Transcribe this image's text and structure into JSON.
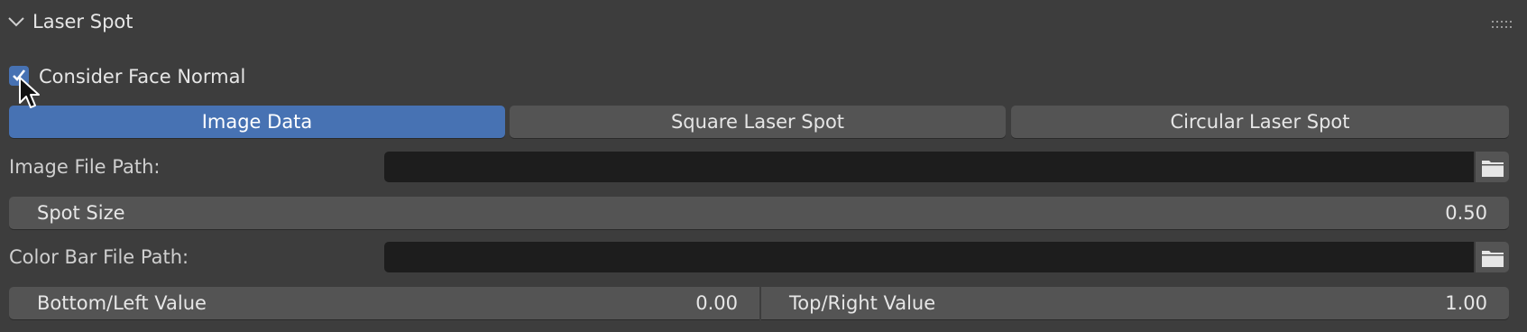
{
  "panel": {
    "title": "Laser Spot",
    "chevron_icon": "chevron-down-icon",
    "grip_icon": "drag-grip-icon"
  },
  "options": {
    "consider_face_normal": {
      "label": "Consider Face Normal",
      "checked": true
    }
  },
  "tabs": [
    {
      "label": "Image Data",
      "active": true
    },
    {
      "label": "Square Laser Spot",
      "active": false
    },
    {
      "label": "Circular Laser Spot",
      "active": false
    }
  ],
  "image_file": {
    "label": "Image File Path:",
    "value": ""
  },
  "spot_size": {
    "label": "Spot Size",
    "value": "0.50"
  },
  "color_bar_file": {
    "label": "Color Bar File Path:",
    "value": ""
  },
  "range": {
    "bottom_left": {
      "label": "Bottom/Left Value",
      "value": "0.00"
    },
    "top_right": {
      "label": "Top/Right Value",
      "value": "1.00"
    }
  },
  "colors": {
    "accent": "#4772b3",
    "panel_bg": "#3d3d3d",
    "field_bg": "#545454",
    "input_bg": "#1d1d1d"
  }
}
